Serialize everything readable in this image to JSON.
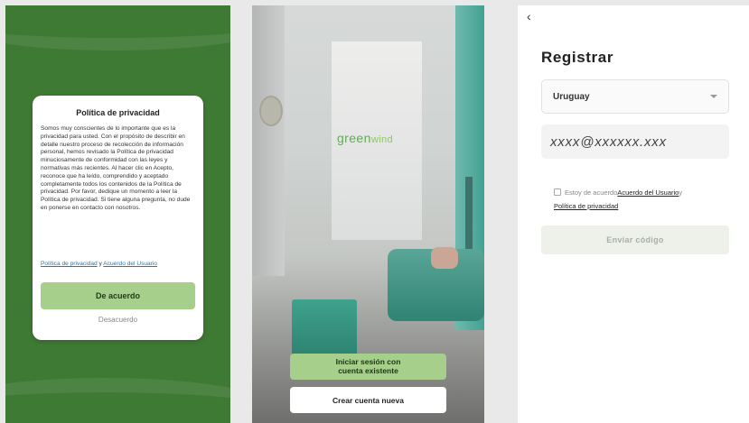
{
  "privacy_dialog": {
    "title": "Política de privacidad",
    "body": "Somos muy conscientes de lo importante que es la privacidad para usted. Con el propósito de describir en detalle nuestro proceso de recolección de información personal, hemos revisado la Política de privacidad minuciosamente de conformidad con las leyes y normativas más recientes. Al hacer clic en Acepto, reconoce que ha leído, comprendido y aceptado completamente todos los contenidos de la Política de privacidad. Por favor, dedique un momento a leer la Política de privacidad. Si tiene alguna pregunta, no dude en ponerse en contacto con nosotros.",
    "link_privacy": "Política de privacidad",
    "link_join": " y ",
    "link_user_agreement": "Acuerdo del Usuario",
    "agree_label": "De acuerdo",
    "disagree_label": "Desacuerdo"
  },
  "welcome": {
    "logo_part1": "green",
    "logo_part2": "wind",
    "login_label_line1": "Iniciar sesión con",
    "login_label_line2": "cuenta existente",
    "create_label": "Crear cuenta nueva"
  },
  "register": {
    "back_glyph": "‹",
    "title": "Registrar",
    "country_value": "Uruguay",
    "email_placeholder": "xxxx@xxxxxx.xxx",
    "terms_prefix": "Estoy de acuerdo",
    "terms_link_user": "Acuerdo del Usuario",
    "terms_join": "y",
    "terms_link_privacy": "Política de privacidad",
    "send_label": "Enviar código"
  },
  "colors": {
    "green_bg": "#3f7a34",
    "accent_green": "#a6cf8b",
    "link_blue": "#2f76a8"
  },
  "icons": [
    "back-chevron-icon",
    "dropdown-caret-icon",
    "checkbox-icon"
  ]
}
